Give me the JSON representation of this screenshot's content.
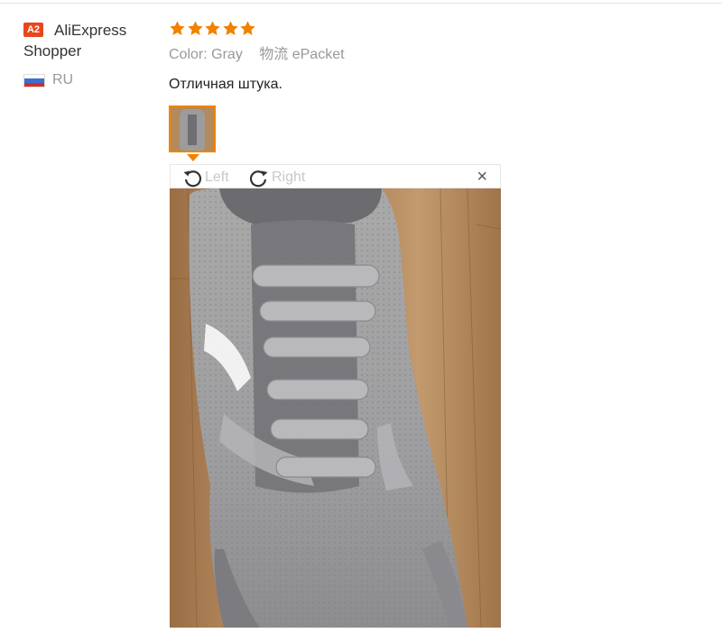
{
  "user": {
    "badge": "A2",
    "name_line1": "AliExpress",
    "name_line2": "Shopper",
    "country_code": "RU"
  },
  "review": {
    "rating": 5,
    "rating_max": 5,
    "star_color": "#f08200",
    "color_label": "Color:",
    "color_value": "Gray",
    "shipping_label": "物流",
    "shipping_value": "ePacket",
    "comment": "Отличная штука."
  },
  "viewer": {
    "rotate_left_label": "Left",
    "rotate_right_label": "Right",
    "close_label": "×"
  },
  "colors": {
    "accent": "#f08200",
    "badge": "#e8471d"
  }
}
